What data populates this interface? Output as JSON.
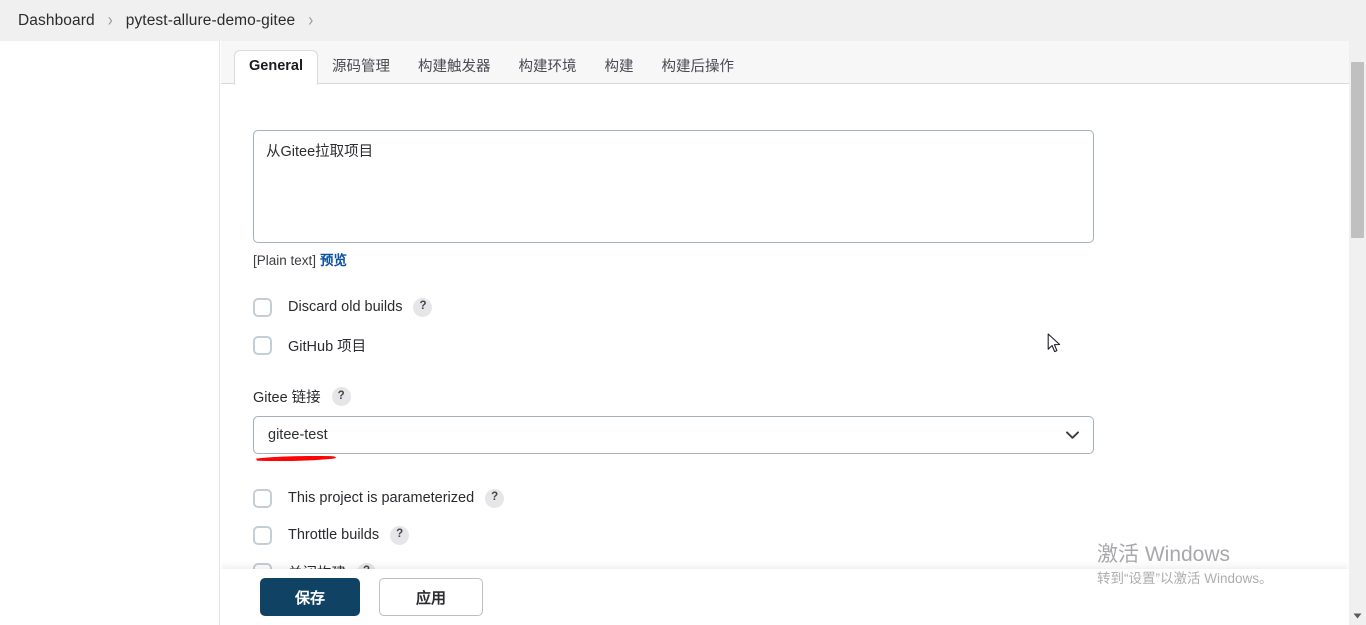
{
  "breadcrumb": {
    "items": [
      {
        "label": "Dashboard"
      },
      {
        "label": "pytest-allure-demo-gitee"
      }
    ],
    "separator": "›",
    "trailing_separator": "›"
  },
  "tabs": [
    {
      "label": "General",
      "active": true
    },
    {
      "label": "源码管理",
      "active": false
    },
    {
      "label": "构建触发器",
      "active": false
    },
    {
      "label": "构建环境",
      "active": false
    },
    {
      "label": "构建",
      "active": false
    },
    {
      "label": "构建后操作",
      "active": false
    }
  ],
  "form": {
    "description": {
      "value": "从Gitee拉取项目",
      "placeholder": ""
    },
    "markup_note": "[Plain text]",
    "preview_link": "预览",
    "checkboxes_top": [
      {
        "label": "Discard old builds",
        "checked": false,
        "help": "?",
        "has_help": true
      },
      {
        "label": "GitHub 项目",
        "checked": false,
        "help": "?",
        "has_help": false
      }
    ],
    "gitee_link": {
      "label": "Gitee 链接",
      "help": "?",
      "selected": "gitee-test",
      "chevron": "chevron-down-icon"
    },
    "checkboxes_bottom": [
      {
        "label": "This project is parameterized",
        "checked": false,
        "help": "?",
        "has_help": true
      },
      {
        "label": "Throttle builds",
        "checked": false,
        "help": "?",
        "has_help": true
      },
      {
        "label": "关闭构建",
        "checked": false,
        "help": "?",
        "has_help": true
      }
    ]
  },
  "footer": {
    "save_label": "保存",
    "apply_label": "应用"
  },
  "watermark": {
    "title": "激活 Windows",
    "subtitle": "转到“设置”以激活 Windows。"
  },
  "colors": {
    "primary_button": "#0f4263",
    "link": "#0b51a1",
    "annotation_red": "#fb0505",
    "breadcrumb_bg": "#f0f0f0",
    "pane_bg": "#f7f7f8"
  }
}
